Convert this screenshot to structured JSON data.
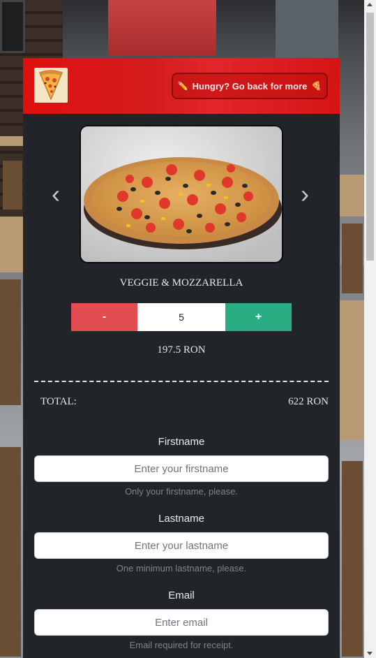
{
  "header": {
    "back_button_label": "Hungry? Go back for more",
    "logo_icon": "pizza-slice-icon",
    "accent": "#e01010"
  },
  "carousel": {
    "prev_symbol": "‹",
    "next_symbol": "›"
  },
  "product": {
    "name": "VEGGIE & MOZZARELLA",
    "quantity": "5",
    "minus_label": "-",
    "plus_label": "+",
    "price": "197.5 RON"
  },
  "total": {
    "label": "TOTAL:",
    "value": "622 RON"
  },
  "form": {
    "firstname": {
      "label": "Firstname",
      "placeholder": "Enter your firstname",
      "help": "Only your firstname, please."
    },
    "lastname": {
      "label": "Lastname",
      "placeholder": "Enter your lastname",
      "help": "One minimum lastname, please."
    },
    "email": {
      "label": "Email",
      "placeholder": "Enter email",
      "help": "Email required for receipt."
    }
  },
  "colors": {
    "panel": "#212529",
    "minus": "#e14d51",
    "plus": "#2bad83"
  }
}
